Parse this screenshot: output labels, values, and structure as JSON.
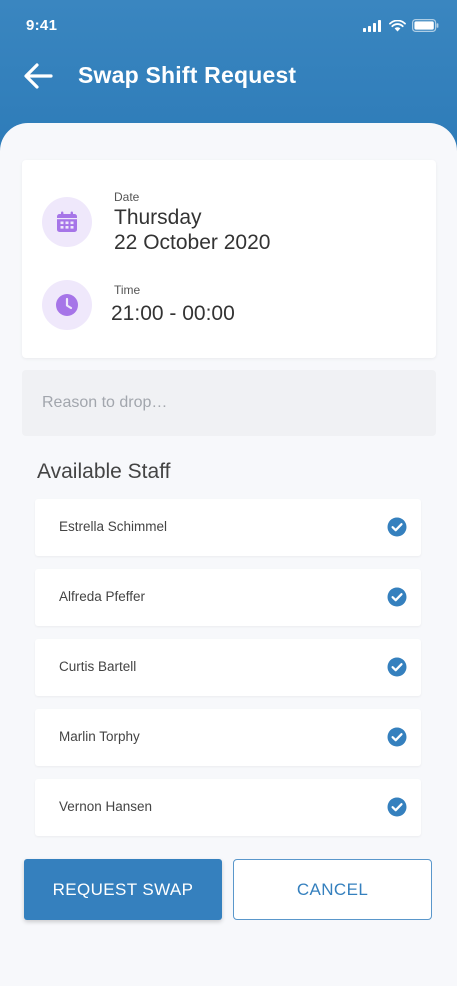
{
  "status_bar": {
    "time": "9:41"
  },
  "header": {
    "title": "Swap Shift Request"
  },
  "shift": {
    "date_label": "Date",
    "date_day": "Thursday",
    "date_full": "22 October 2020",
    "time_label": "Time",
    "time_value": "21:00 - 00:00"
  },
  "reason": {
    "placeholder": "Reason to drop…",
    "value": ""
  },
  "staff": {
    "title": "Available Staff",
    "items": [
      {
        "name": "Estrella Schimmel",
        "selected": true
      },
      {
        "name": "Alfreda Pfeffer",
        "selected": true
      },
      {
        "name": "Curtis Bartell",
        "selected": true
      },
      {
        "name": "Marlin Torphy",
        "selected": true
      },
      {
        "name": "Vernon Hansen",
        "selected": true
      }
    ]
  },
  "actions": {
    "request_label": "REQUEST SWAP",
    "cancel_label": "CANCEL"
  },
  "colors": {
    "primary": "#3580be",
    "accent_purple": "#a675e8",
    "icon_bg": "#efe8fb"
  }
}
